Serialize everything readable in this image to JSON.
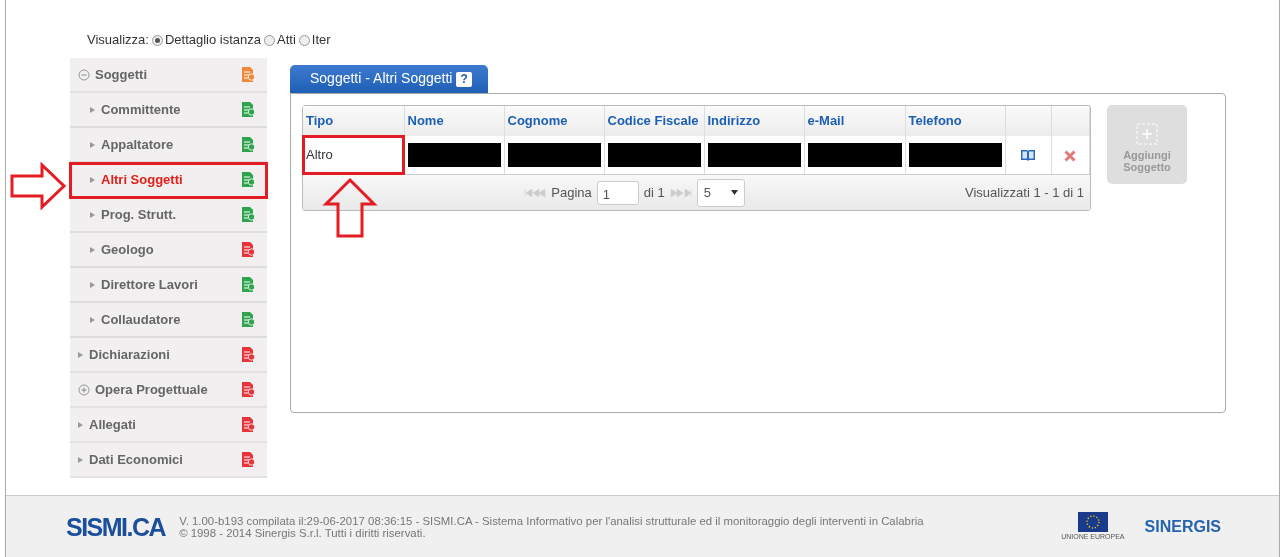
{
  "view_selector": {
    "label": "Visualizza:",
    "options": [
      {
        "label": "Dettaglio istanza",
        "selected": true
      },
      {
        "label": "Atti",
        "selected": false
      },
      {
        "label": "Iter",
        "selected": false
      }
    ]
  },
  "sidebar": {
    "items": [
      {
        "label": "Soggetti",
        "kind": "group",
        "expanded": true,
        "color": "#f0883a",
        "selected": false,
        "annotated": false,
        "children": [
          {
            "label": "Committente",
            "color": "#2ea44f",
            "selected": false,
            "annotated": false
          },
          {
            "label": "Appaltatore",
            "color": "#2ea44f",
            "selected": false,
            "annotated": false
          },
          {
            "label": "Altri Soggetti",
            "color": "#2ea44f",
            "selected": true,
            "annotated": true
          },
          {
            "label": "Prog. Strutt.",
            "color": "#2ea44f",
            "selected": false,
            "annotated": false
          },
          {
            "label": "Geologo",
            "color": "#e8333a",
            "selected": false,
            "annotated": false
          },
          {
            "label": "Direttore Lavori",
            "color": "#2ea44f",
            "selected": false,
            "annotated": false
          },
          {
            "label": "Collaudatore",
            "color": "#2ea44f",
            "selected": false,
            "annotated": false
          }
        ]
      },
      {
        "label": "Dichiarazioni",
        "kind": "leaf",
        "color": "#e8333a",
        "selected": false,
        "annotated": false
      },
      {
        "label": "Opera Progettuale",
        "kind": "group",
        "expanded": false,
        "color": "#e8333a",
        "selected": false,
        "annotated": false
      },
      {
        "label": "Allegati",
        "kind": "leaf",
        "color": "#e8333a",
        "selected": false,
        "annotated": false
      },
      {
        "label": "Dati Economici",
        "kind": "leaf",
        "color": "#e8333a",
        "selected": false,
        "annotated": false
      }
    ]
  },
  "panel": {
    "title": "Soggetti - Altri Soggetti",
    "help": "?",
    "table": {
      "columns": [
        "Tipo",
        "Nome",
        "Cognome",
        "Codice Fiscale",
        "Indirizzo",
        "e-Mail",
        "Telefono"
      ],
      "rows": [
        {
          "cells": [
            {
              "text": "Altro",
              "annotated": true
            },
            {
              "redacted": true
            },
            {
              "redacted": true
            },
            {
              "redacted": true
            },
            {
              "redacted": true
            },
            {
              "redacted": true
            },
            {
              "redacted": true
            }
          ]
        }
      ]
    },
    "pager": {
      "page_label": "Pagina",
      "page": "1",
      "of": "di 1",
      "page_size": "5",
      "summary": "Visualizzati 1 - 1 di 1"
    },
    "add_button": {
      "label": "Aggiungi Soggetto",
      "disabled": true
    }
  },
  "footer": {
    "logo": "SISMI.CA",
    "lines": [
      "V. 1.00-b193 compilata il:29-06-2017 08:36:15 - SISMI.CA - Sistema Informativo per l'analisi strutturale ed il monitoraggio degli interventi in Calabria",
      "© 1998 - 2014 Sinergis S.r.l. Tutti i diritti riservati."
    ],
    "eu_caption": "UNIONE EUROPEA",
    "partner": "SINERGIS"
  }
}
